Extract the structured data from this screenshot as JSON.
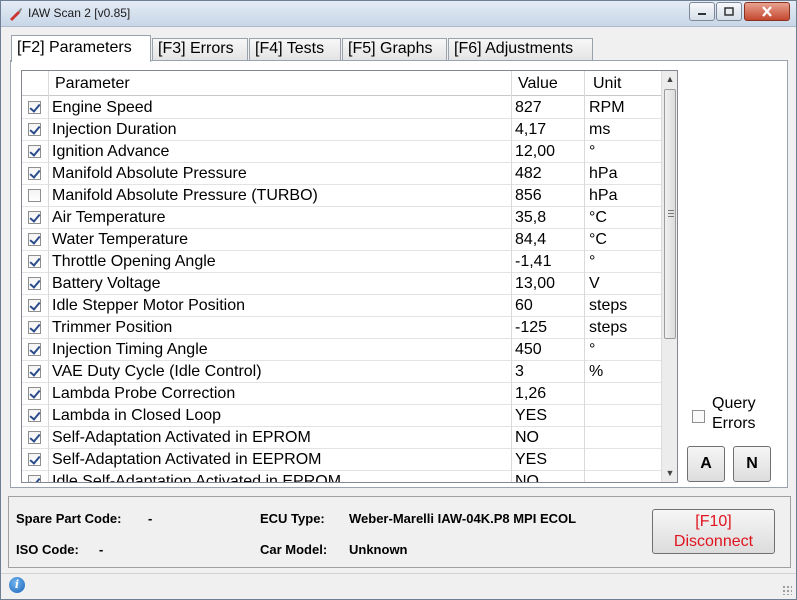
{
  "window": {
    "title": "IAW Scan 2 [v0.85]",
    "close_color": "#c4482f"
  },
  "tabs": [
    {
      "label": "[F2] Parameters",
      "active": true
    },
    {
      "label": "[F3] Errors",
      "active": false
    },
    {
      "label": "[F4] Tests",
      "active": false
    },
    {
      "label": "[F5] Graphs",
      "active": false
    },
    {
      "label": "[F6] Adjustments",
      "active": false
    }
  ],
  "grid": {
    "headers": {
      "parameter": "Parameter",
      "value": "Value",
      "unit": "Unit"
    },
    "rows": [
      {
        "checked": true,
        "parameter": "Engine Speed",
        "value": "827",
        "unit": "RPM"
      },
      {
        "checked": true,
        "parameter": "Injection Duration",
        "value": "4,17",
        "unit": "ms"
      },
      {
        "checked": true,
        "parameter": "Ignition Advance",
        "value": "12,00",
        "unit": "°"
      },
      {
        "checked": true,
        "parameter": "Manifold Absolute Pressure",
        "value": "482",
        "unit": "hPa"
      },
      {
        "checked": false,
        "parameter": "Manifold Absolute Pressure (TURBO)",
        "value": "856",
        "unit": "hPa"
      },
      {
        "checked": true,
        "parameter": "Air Temperature",
        "value": "35,8",
        "unit": "°C"
      },
      {
        "checked": true,
        "parameter": "Water Temperature",
        "value": "84,4",
        "unit": "°C"
      },
      {
        "checked": true,
        "parameter": "Throttle Opening Angle",
        "value": "-1,41",
        "unit": "°"
      },
      {
        "checked": true,
        "parameter": "Battery Voltage",
        "value": "13,00",
        "unit": "V"
      },
      {
        "checked": true,
        "parameter": "Idle Stepper Motor Position",
        "value": "60",
        "unit": "steps"
      },
      {
        "checked": true,
        "parameter": "Trimmer Position",
        "value": "-125",
        "unit": "steps"
      },
      {
        "checked": true,
        "parameter": "Injection Timing Angle",
        "value": "450",
        "unit": "°"
      },
      {
        "checked": true,
        "parameter": "VAE Duty Cycle (Idle Control)",
        "value": "3",
        "unit": "%"
      },
      {
        "checked": true,
        "parameter": "Lambda Probe Correction",
        "value": "1,26",
        "unit": ""
      },
      {
        "checked": true,
        "parameter": "Lambda in Closed Loop",
        "value": "YES",
        "unit": ""
      },
      {
        "checked": true,
        "parameter": "Self-Adaptation Activated in EPROM",
        "value": "NO",
        "unit": ""
      },
      {
        "checked": true,
        "parameter": "Self-Adaptation Activated in EEPROM",
        "value": "YES",
        "unit": ""
      },
      {
        "checked": true,
        "parameter": "Idle Self-Adaptation Activated in EPROM",
        "value": "NO",
        "unit": ""
      }
    ]
  },
  "side": {
    "query_label": "Query Errors",
    "query_checked": false,
    "btn_a": "A",
    "btn_n": "N"
  },
  "info": {
    "spare_part_label": "Spare Part Code:",
    "spare_part_value": "-",
    "iso_label": "ISO Code:",
    "iso_value": "-",
    "ecu_label": "ECU Type:",
    "ecu_value": "Weber-Marelli IAW-04K.P8 MPI ECOL",
    "car_label": "Car Model:",
    "car_value": "Unknown"
  },
  "disconnect": {
    "key": "[F10]",
    "label": "Disconnect",
    "color": "#e0141e"
  },
  "statusbar": {
    "icon": "info-icon"
  }
}
